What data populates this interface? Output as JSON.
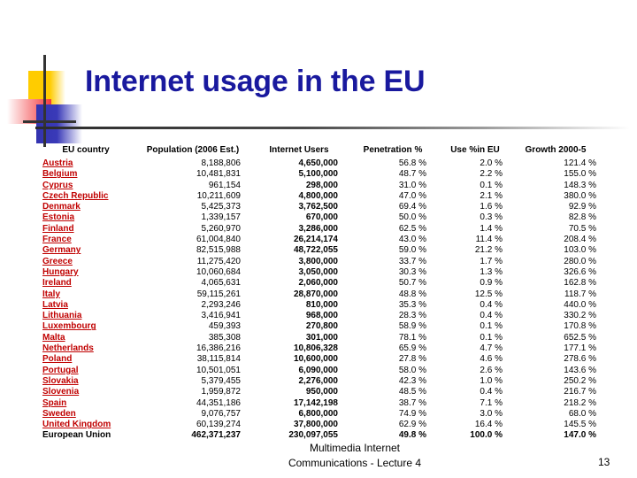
{
  "slide": {
    "title": "Internet usage in the EU",
    "title_color": "#19199e",
    "link_color": "#c00000"
  },
  "decoration": {
    "yellow_color": "#ffcc00",
    "red_color": "#f4383c",
    "blue_color": "#3333b0",
    "line_color": "#333333"
  },
  "table": {
    "headers": {
      "country": "EU country",
      "population": "Population (2006 Est.)",
      "users": "Internet Users",
      "penetration": "Penetration %",
      "use_in_eu": "Use %in EU",
      "growth": "Growth 2000-5"
    },
    "rows": [
      {
        "country": "Austria",
        "population": "8,188,806",
        "users": "4,650,000",
        "penetration": "56.8 %",
        "use_in_eu": "2.0 %",
        "growth": "121.4 %"
      },
      {
        "country": "Belgium",
        "population": "10,481,831",
        "users": "5,100,000",
        "penetration": "48.7 %",
        "use_in_eu": "2.2 %",
        "growth": "155.0 %"
      },
      {
        "country": "Cyprus",
        "population": "961,154",
        "users": "298,000",
        "penetration": "31.0 %",
        "use_in_eu": "0.1 %",
        "growth": "148.3 %"
      },
      {
        "country": "Czech Republic",
        "population": "10,211,609",
        "users": "4,800,000",
        "penetration": "47.0 %",
        "use_in_eu": "2.1 %",
        "growth": "380.0 %"
      },
      {
        "country": "Denmark",
        "population": "5,425,373",
        "users": "3,762,500",
        "penetration": "69.4 %",
        "use_in_eu": "1.6 %",
        "growth": "92.9 %"
      },
      {
        "country": "Estonia",
        "population": "1,339,157",
        "users": "670,000",
        "penetration": "50.0 %",
        "use_in_eu": "0.3 %",
        "growth": "82.8 %"
      },
      {
        "country": "Finland",
        "population": "5,260,970",
        "users": "3,286,000",
        "penetration": "62.5 %",
        "use_in_eu": "1.4 %",
        "growth": "70.5 %"
      },
      {
        "country": "France",
        "population": "61,004,840",
        "users": "26,214,174",
        "penetration": "43.0 %",
        "use_in_eu": "11.4 %",
        "growth": "208.4 %"
      },
      {
        "country": "Germany",
        "population": "82,515,988",
        "users": "48,722,055",
        "penetration": "59.0 %",
        "use_in_eu": "21.2 %",
        "growth": "103.0 %"
      },
      {
        "country": "Greece",
        "population": "11,275,420",
        "users": "3,800,000",
        "penetration": "33.7 %",
        "use_in_eu": "1.7 %",
        "growth": "280.0 %"
      },
      {
        "country": "Hungary",
        "population": "10,060,684",
        "users": "3,050,000",
        "penetration": "30.3 %",
        "use_in_eu": "1.3 %",
        "growth": "326.6 %"
      },
      {
        "country": "Ireland",
        "population": "4,065,631",
        "users": "2,060,000",
        "penetration": "50.7 %",
        "use_in_eu": "0.9 %",
        "growth": "162.8 %"
      },
      {
        "country": "Italy",
        "population": "59,115,261",
        "users": "28,870,000",
        "penetration": "48.8 %",
        "use_in_eu": "12.5 %",
        "growth": "118.7 %"
      },
      {
        "country": "Latvia",
        "population": "2,293,246",
        "users": "810,000",
        "penetration": "35.3 %",
        "use_in_eu": "0.4 %",
        "growth": "440.0 %"
      },
      {
        "country": "Lithuania",
        "population": "3,416,941",
        "users": "968,000",
        "penetration": "28.3 %",
        "use_in_eu": "0.4 %",
        "growth": "330.2 %"
      },
      {
        "country": "Luxembourg",
        "population": "459,393",
        "users": "270,800",
        "penetration": "58.9 %",
        "use_in_eu": "0.1 %",
        "growth": "170.8 %"
      },
      {
        "country": "Malta",
        "population": "385,308",
        "users": "301,000",
        "penetration": "78.1 %",
        "use_in_eu": "0.1 %",
        "growth": "652.5 %"
      },
      {
        "country": "Netherlands",
        "population": "16,386,216",
        "users": "10,806,328",
        "penetration": "65.9 %",
        "use_in_eu": "4.7 %",
        "growth": "177.1 %"
      },
      {
        "country": "Poland",
        "population": "38,115,814",
        "users": "10,600,000",
        "penetration": "27.8 %",
        "use_in_eu": "4.6 %",
        "growth": "278.6 %"
      },
      {
        "country": "Portugal",
        "population": "10,501,051",
        "users": "6,090,000",
        "penetration": "58.0 %",
        "use_in_eu": "2.6 %",
        "growth": "143.6 %"
      },
      {
        "country": "Slovakia",
        "population": "5,379,455",
        "users": "2,276,000",
        "penetration": "42.3 %",
        "use_in_eu": "1.0 %",
        "growth": "250.2 %"
      },
      {
        "country": "Slovenia",
        "population": "1,959,872",
        "users": "950,000",
        "penetration": "48.5 %",
        "use_in_eu": "0.4 %",
        "growth": "216.7 %"
      },
      {
        "country": "Spain",
        "population": "44,351,186",
        "users": "17,142,198",
        "penetration": "38.7 %",
        "use_in_eu": "7.1 %",
        "growth": "218.2 %"
      },
      {
        "country": "Sweden",
        "population": "9,076,757",
        "users": "6,800,000",
        "penetration": "74.9 %",
        "use_in_eu": "3.0 %",
        "growth": "68.0 %"
      },
      {
        "country": "United Kingdom",
        "population": "60,139,274",
        "users": "37,800,000",
        "penetration": "62.9 %",
        "use_in_eu": "16.4 %",
        "growth": "145.5 %"
      }
    ],
    "total": {
      "country": "European Union",
      "population": "462,371,237",
      "users": "230,097,055",
      "penetration": "49.8 %",
      "use_in_eu": "100.0 %",
      "growth": "147.0 %"
    }
  },
  "footer": {
    "line1": "Multimedia Internet",
    "line2": "Communications - Lecture 4",
    "page_number": "13"
  }
}
